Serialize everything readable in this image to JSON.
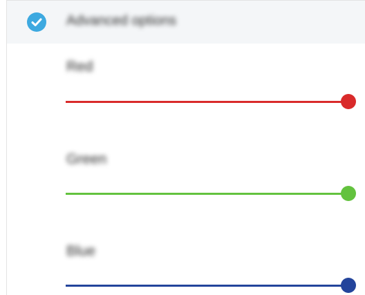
{
  "header": {
    "title": "Advanced options",
    "icon": "check-circle-icon",
    "icon_color": "#3da9e0",
    "checked": true
  },
  "sliders": [
    {
      "label": "Red",
      "value": 1.0,
      "color": "#d92a2a"
    },
    {
      "label": "Green",
      "value": 1.0,
      "color": "#63c23e"
    },
    {
      "label": "Blue",
      "value": 1.0,
      "color": "#23449b"
    }
  ]
}
